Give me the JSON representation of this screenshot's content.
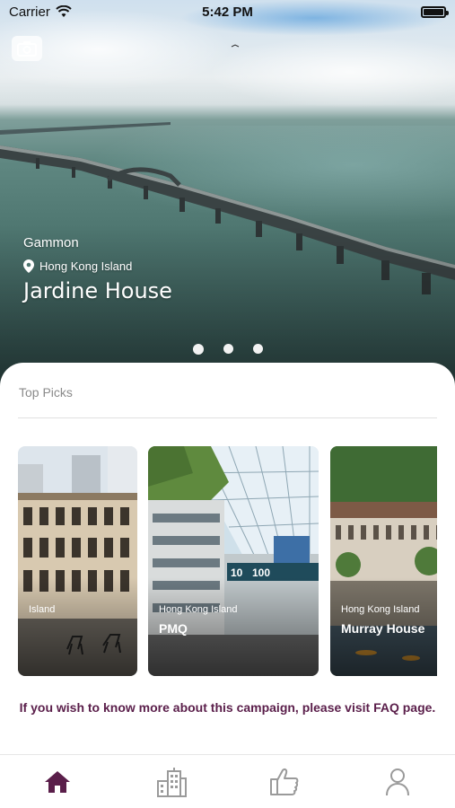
{
  "status_bar": {
    "carrier": "Carrier",
    "time": "5:42 PM"
  },
  "hero": {
    "organization": "Gammon",
    "district": "Hong Kong Island",
    "title": "Jardine House",
    "location_icon": "location-pin-icon",
    "camera_icon": "camera-icon",
    "pages": 3,
    "active_page": 1
  },
  "top_picks": {
    "title": "Top Picks",
    "cards": [
      {
        "district": "Island",
        "name": ""
      },
      {
        "district": "Hong Kong Island",
        "name": "PMQ"
      },
      {
        "district": "Hong Kong Island",
        "name": "Murray House"
      }
    ]
  },
  "faq_text": "If you wish to know more about this campaign, please visit FAQ page.",
  "tab_bar": {
    "icons": [
      "home-icon",
      "buildings-icon",
      "thumbs-up-icon",
      "profile-icon"
    ],
    "active_color": "#5a1e4a",
    "inactive_color": "#9a9a9a"
  }
}
